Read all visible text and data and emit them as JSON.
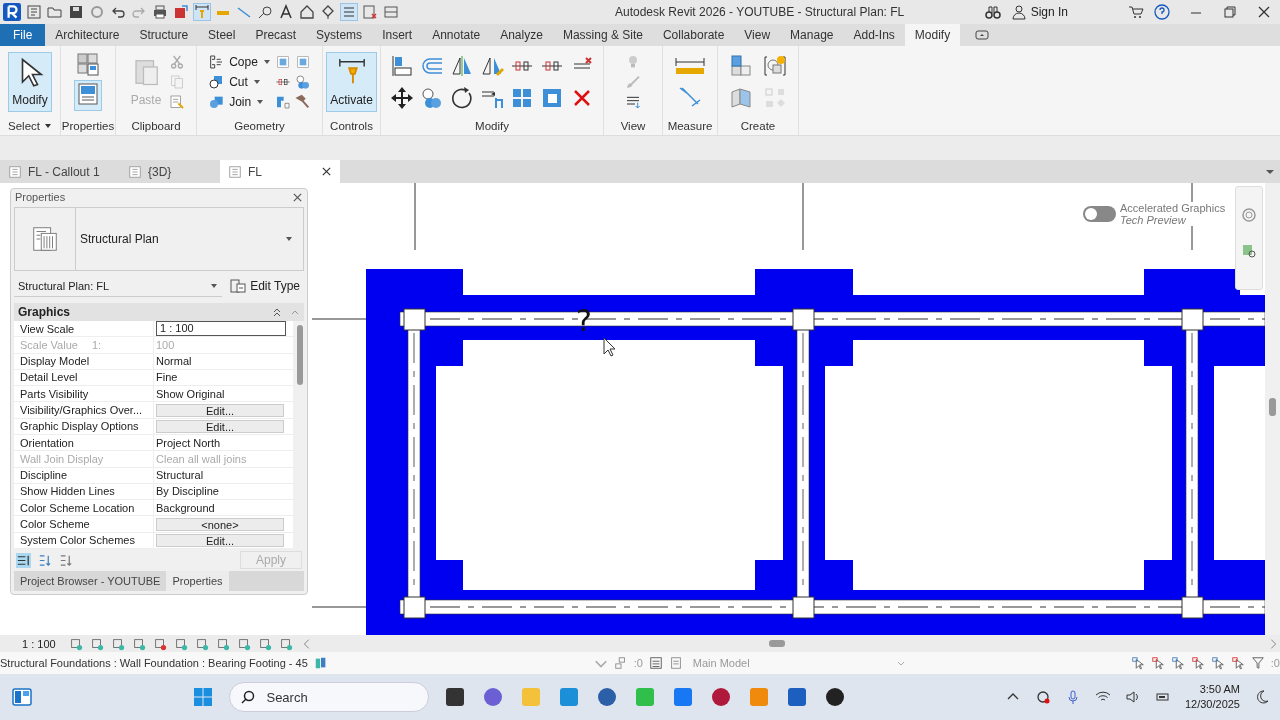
{
  "title_bar": {
    "title": "Autodesk Revit 2026 - YOUTUBE - Structural Plan: FL",
    "sign_in": "Sign In"
  },
  "menu_tabs": [
    {
      "label": "File",
      "kind": "file",
      "selected": false
    },
    {
      "label": "Architecture",
      "kind": "tab",
      "selected": false
    },
    {
      "label": "Structure",
      "kind": "tab",
      "selected": false
    },
    {
      "label": "Steel",
      "kind": "tab",
      "selected": false
    },
    {
      "label": "Precast",
      "kind": "tab",
      "selected": false
    },
    {
      "label": "Systems",
      "kind": "tab",
      "selected": false
    },
    {
      "label": "Insert",
      "kind": "tab",
      "selected": false
    },
    {
      "label": "Annotate",
      "kind": "tab",
      "selected": false
    },
    {
      "label": "Analyze",
      "kind": "tab",
      "selected": false
    },
    {
      "label": "Massing & Site",
      "kind": "tab",
      "selected": false
    },
    {
      "label": "Collaborate",
      "kind": "tab",
      "selected": false
    },
    {
      "label": "View",
      "kind": "tab",
      "selected": false
    },
    {
      "label": "Manage",
      "kind": "tab",
      "selected": false
    },
    {
      "label": "Add-Ins",
      "kind": "tab",
      "selected": false
    },
    {
      "label": "Modify",
      "kind": "tab",
      "selected": true
    }
  ],
  "ribbon_panels": [
    {
      "label": "Select",
      "tools": [
        {
          "label": "Modify",
          "selected": true
        }
      ]
    },
    {
      "label": "Properties",
      "tools": [
        {
          "selected": true
        }
      ]
    },
    {
      "label": "Clipboard",
      "tools": [
        {
          "label": "Paste",
          "disabled": true
        }
      ]
    },
    {
      "label": "Geometry",
      "tools": [
        {
          "label": "Cope"
        },
        {
          "label": "Cut"
        },
        {
          "label": "Join"
        }
      ]
    },
    {
      "label": "Controls",
      "tools": [
        {
          "label": "Activate",
          "selected": true
        }
      ]
    },
    {
      "label": "Modify"
    },
    {
      "label": "View"
    },
    {
      "label": "Measure"
    },
    {
      "label": "Create"
    }
  ],
  "view_tabs": [
    {
      "label": "FL - Callout 1",
      "selected": false
    },
    {
      "label": "{3D}",
      "selected": false
    },
    {
      "label": "FL",
      "selected": true
    }
  ],
  "properties": {
    "title": "Properties",
    "type_name": "Structural Plan",
    "instance": "Structural Plan: FL",
    "edit_type": "Edit Type",
    "group": "Graphics",
    "rows": [
      {
        "label": "View Scale",
        "value": "1 : 100",
        "kind": "input",
        "disabled": false
      },
      {
        "label": "Scale Value",
        "unit": "1:",
        "value": "100",
        "kind": "text",
        "disabled": true
      },
      {
        "label": "Display Model",
        "value": "Normal",
        "kind": "text",
        "disabled": false
      },
      {
        "label": "Detail Level",
        "value": "Fine",
        "kind": "text",
        "disabled": false
      },
      {
        "label": "Parts Visibility",
        "value": "Show Original",
        "kind": "text",
        "disabled": false
      },
      {
        "label": "Visibility/Graphics Over...",
        "value": "Edit...",
        "kind": "button",
        "disabled": false
      },
      {
        "label": "Graphic Display Options",
        "value": "Edit...",
        "kind": "button",
        "disabled": false
      },
      {
        "label": "Orientation",
        "value": "Project North",
        "kind": "text",
        "disabled": false
      },
      {
        "label": "Wall Join Display",
        "value": "Clean all wall joins",
        "kind": "text",
        "disabled": true
      },
      {
        "label": "Discipline",
        "value": "Structural",
        "kind": "text",
        "disabled": false
      },
      {
        "label": "Show Hidden Lines",
        "value": "By Discipline",
        "kind": "text",
        "disabled": false
      },
      {
        "label": "Color Scheme Location",
        "value": "Background",
        "kind": "text",
        "disabled": false
      },
      {
        "label": "Color Scheme",
        "value": "<none>",
        "kind": "button",
        "disabled": false
      },
      {
        "label": "System Color Schemes",
        "value": "Edit...",
        "kind": "button",
        "disabled": false
      }
    ],
    "apply": {
      "label": "Apply",
      "disabled": true
    },
    "tabs": [
      {
        "label": "Project Browser - YOUTUBE",
        "selected": false
      },
      {
        "label": "Properties",
        "selected": true
      }
    ]
  },
  "canvas": {
    "toggle": {
      "label": "Accelerated Graphics",
      "sublabel": "Tech Preview",
      "on": false
    },
    "tag": "?"
  },
  "view_control_bar": {
    "scale": "1 : 100"
  },
  "status_bar": {
    "text": "Structural Foundations : Wall Foundation : Bearing Footing - 45",
    "workset_count": ":0",
    "model": "Main Model",
    "filter_count": ":0"
  },
  "taskbar": {
    "search_placeholder": "Search",
    "time": "3:50 AM",
    "date": "12/30/2025"
  }
}
